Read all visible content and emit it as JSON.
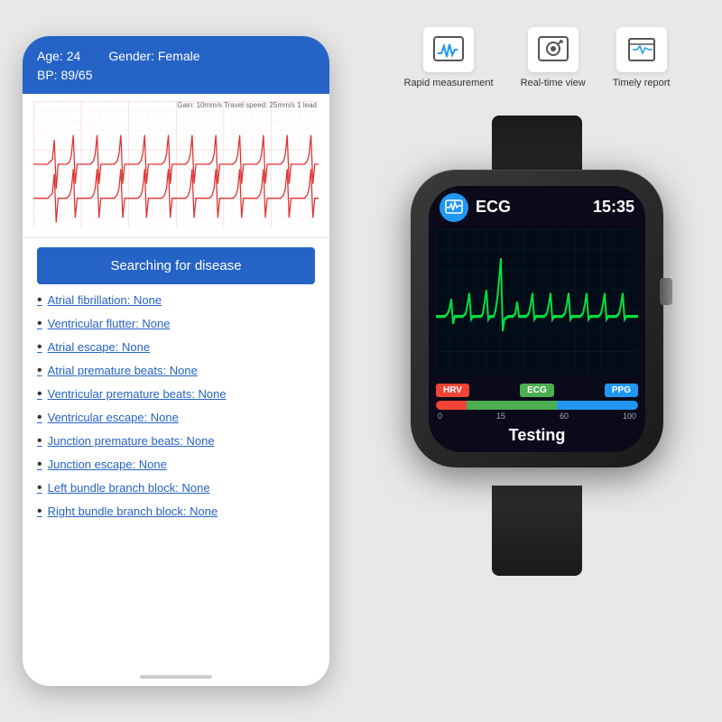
{
  "phone": {
    "header": {
      "age_label": "Age: 24",
      "gender_label": "Gender: Female",
      "bp_label": "BP: 89/65"
    },
    "search_button": "Searching for disease",
    "diseases": [
      {
        "name": "Atrial fibrillation:",
        "value": "None"
      },
      {
        "name": "Ventricular flutter:",
        "value": "None"
      },
      {
        "name": "Atrial escape:",
        "value": "None"
      },
      {
        "name": "Atrial premature beats:",
        "value": "None"
      },
      {
        "name": "Ventricular premature beats:",
        "value": "None"
      },
      {
        "name": "Ventricular escape:",
        "value": "None"
      },
      {
        "name": "Junction premature beats:",
        "value": "None"
      },
      {
        "name": "Junction escape:",
        "value": "None"
      },
      {
        "name": "Left bundle branch block:",
        "value": "None"
      },
      {
        "name": "Right bundle branch block:",
        "value": "None"
      }
    ]
  },
  "features": [
    {
      "icon": "ecg-icon",
      "label": "Rapid measurement"
    },
    {
      "icon": "search-icon",
      "label": "Real-time view"
    },
    {
      "icon": "report-icon",
      "label": "Timely report"
    }
  ],
  "watch": {
    "app_name": "ECG",
    "time": "15:35",
    "bars": {
      "hrv": "HRV",
      "ecg": "ECG",
      "ppg": "PPG",
      "tick_0": "0",
      "tick_15": "15",
      "tick_60": "60",
      "tick_100": "100"
    },
    "status": "Testing"
  }
}
